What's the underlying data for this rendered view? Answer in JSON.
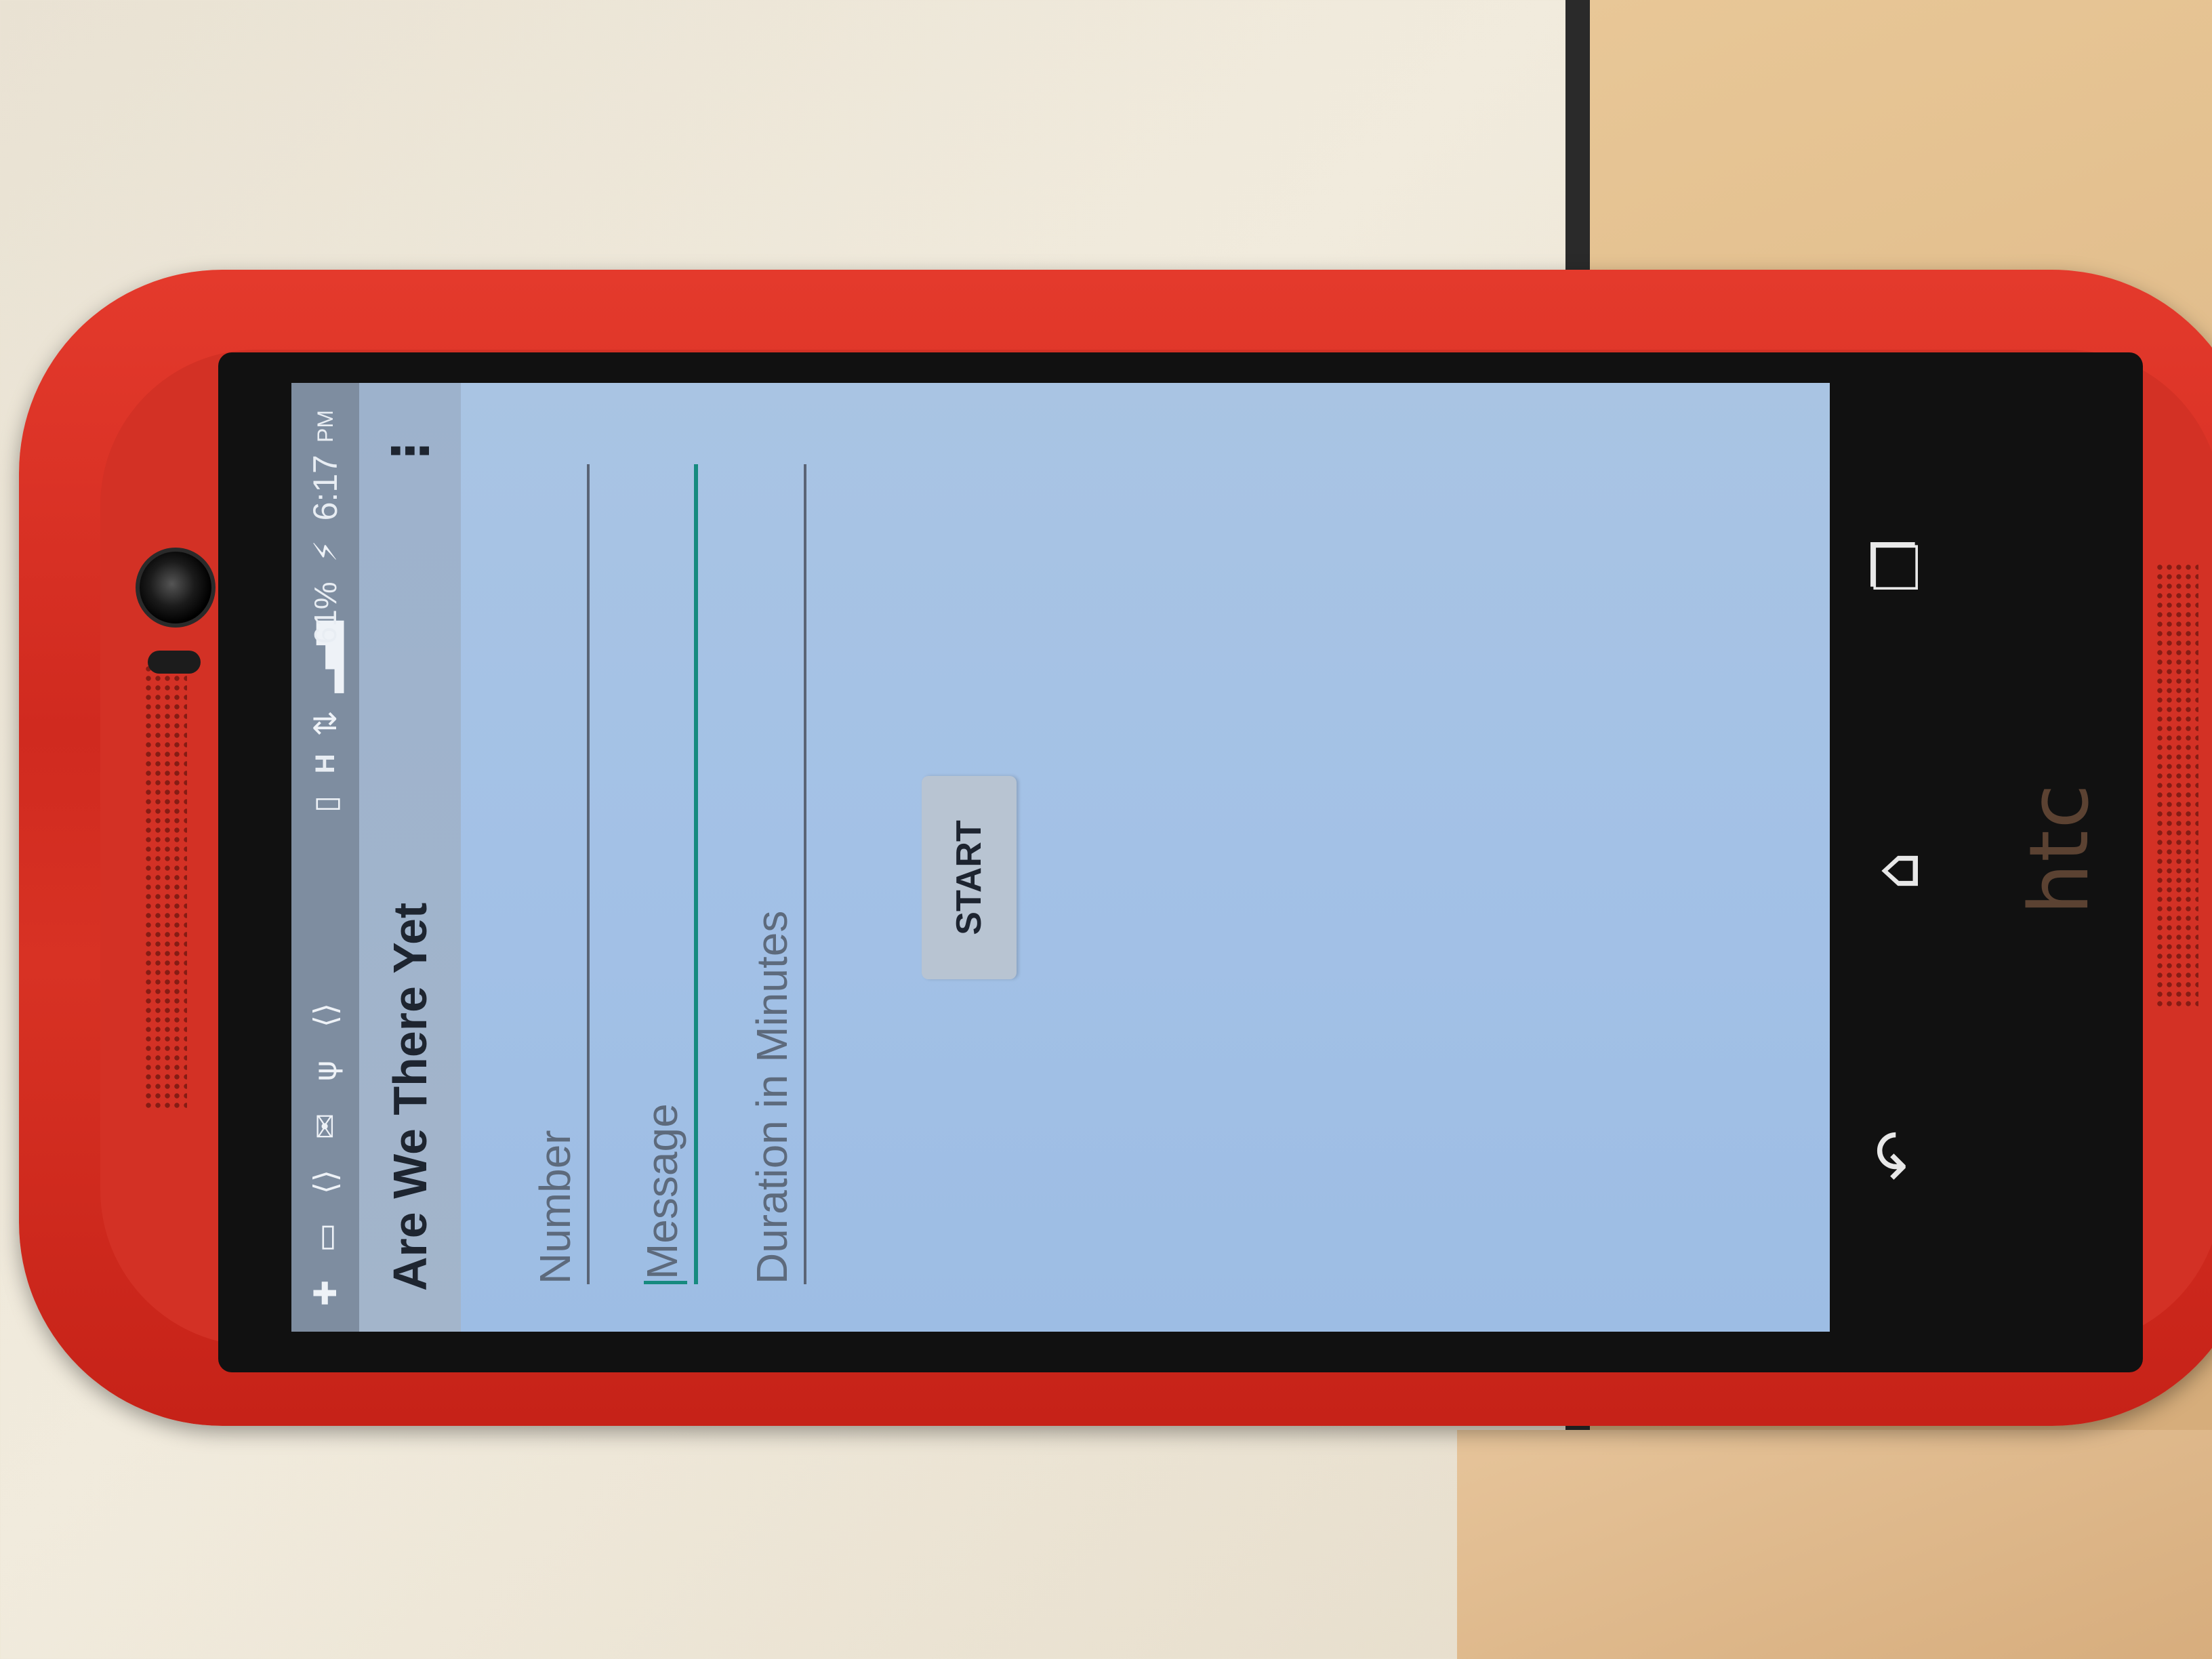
{
  "status_bar": {
    "battery_percent": "61%",
    "time": "6:17",
    "time_suffix": "PM",
    "network": "H"
  },
  "app": {
    "title": "Are We There Yet"
  },
  "form": {
    "number_placeholder": "Number",
    "message_placeholder": "Message",
    "duration_placeholder": "Duration in Minutes",
    "start_label": "START"
  },
  "device": {
    "brand": "htc"
  },
  "colors": {
    "case": "#d33125",
    "accent": "#168a7f",
    "screen_bg": "#a3c1e6"
  }
}
